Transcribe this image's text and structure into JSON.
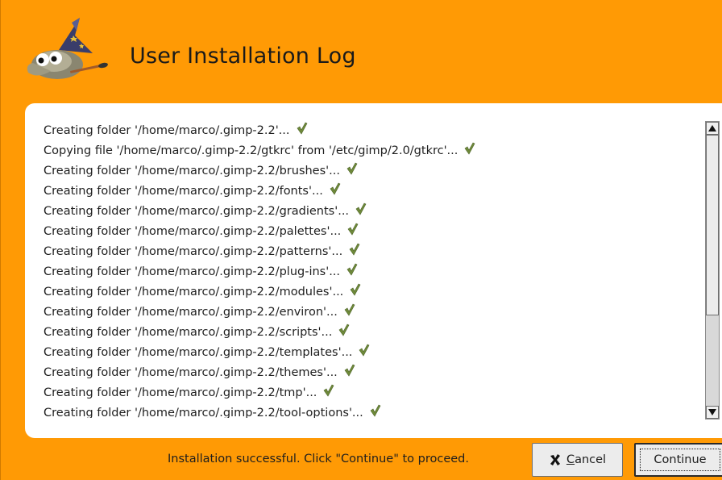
{
  "dialog": {
    "title": "User Installation Log",
    "logo_icon": "gimp-wilber-icon"
  },
  "log": {
    "lines": [
      {
        "text": "Creating folder '/home/marco/.gimp-2.2'...",
        "status_icon": "check-icon"
      },
      {
        "text": "Copying file '/home/marco/.gimp-2.2/gtkrc' from '/etc/gimp/2.0/gtkrc'...",
        "status_icon": "check-icon"
      },
      {
        "text": "Creating folder '/home/marco/.gimp-2.2/brushes'...",
        "status_icon": "check-icon"
      },
      {
        "text": "Creating folder '/home/marco/.gimp-2.2/fonts'...",
        "status_icon": "check-icon"
      },
      {
        "text": "Creating folder '/home/marco/.gimp-2.2/gradients'...",
        "status_icon": "check-icon"
      },
      {
        "text": "Creating folder '/home/marco/.gimp-2.2/palettes'...",
        "status_icon": "check-icon"
      },
      {
        "text": "Creating folder '/home/marco/.gimp-2.2/patterns'...",
        "status_icon": "check-icon"
      },
      {
        "text": "Creating folder '/home/marco/.gimp-2.2/plug-ins'...",
        "status_icon": "check-icon"
      },
      {
        "text": "Creating folder '/home/marco/.gimp-2.2/modules'...",
        "status_icon": "check-icon"
      },
      {
        "text": "Creating folder '/home/marco/.gimp-2.2/environ'...",
        "status_icon": "check-icon"
      },
      {
        "text": "Creating folder '/home/marco/.gimp-2.2/scripts'...",
        "status_icon": "check-icon"
      },
      {
        "text": "Creating folder '/home/marco/.gimp-2.2/templates'...",
        "status_icon": "check-icon"
      },
      {
        "text": "Creating folder '/home/marco/.gimp-2.2/themes'...",
        "status_icon": "check-icon"
      },
      {
        "text": "Creating folder '/home/marco/.gimp-2.2/tmp'...",
        "status_icon": "check-icon"
      },
      {
        "text": "Creating folder '/home/marco/.gimp-2.2/tool-options'...",
        "status_icon": "check-icon"
      }
    ]
  },
  "footer": {
    "status_text": "Installation successful.  Click \"Continue\" to proceed.",
    "cancel": {
      "mnemonic": "C",
      "rest": "ancel",
      "icon": "cancel-x-icon"
    },
    "continue_label": "Continue"
  },
  "colors": {
    "background": "#ff9a05",
    "check": "#6f8a3a"
  }
}
